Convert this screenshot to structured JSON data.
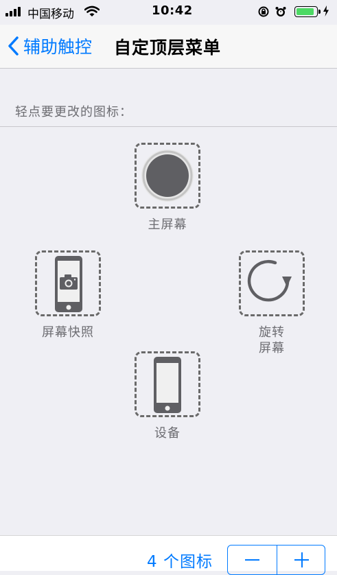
{
  "status_bar": {
    "carrier": "中国移动",
    "time": "10:42",
    "battery_level": 0.9
  },
  "nav": {
    "back_label": "辅助触控",
    "title": "自定顶层菜单"
  },
  "instruction": "轻点要更改的图标：",
  "icons": [
    {
      "label": "主屏幕",
      "icon": "home-button-icon"
    },
    {
      "label": "屏幕快照",
      "icon": "screenshot-icon"
    },
    {
      "label": "旋转\n屏幕",
      "icon": "rotate-screen-icon"
    },
    {
      "label": "设备",
      "icon": "device-icon"
    }
  ],
  "bottom": {
    "count_label": "4 个图标",
    "minus_icon": "minus-icon",
    "plus_icon": "plus-icon"
  },
  "colors": {
    "accent": "#007aff",
    "background": "#efeff4",
    "icon_gray": "#6a6a6a",
    "battery": "#4cd964"
  }
}
